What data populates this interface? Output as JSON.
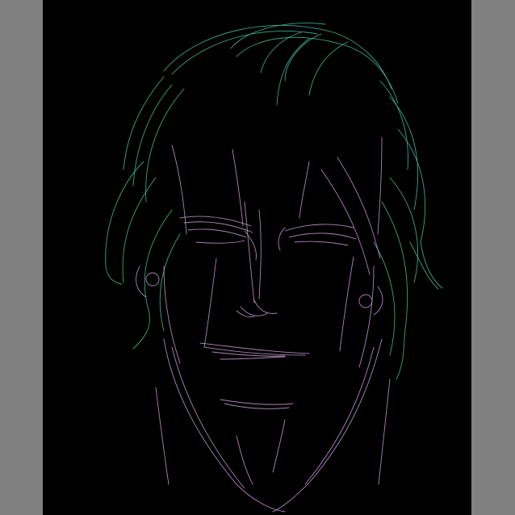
{
  "view": {
    "background_color": "#808080",
    "canvas_color": "#000000",
    "hair_line_color": "#3fb59a",
    "face_line_color": "#c79bd6"
  }
}
